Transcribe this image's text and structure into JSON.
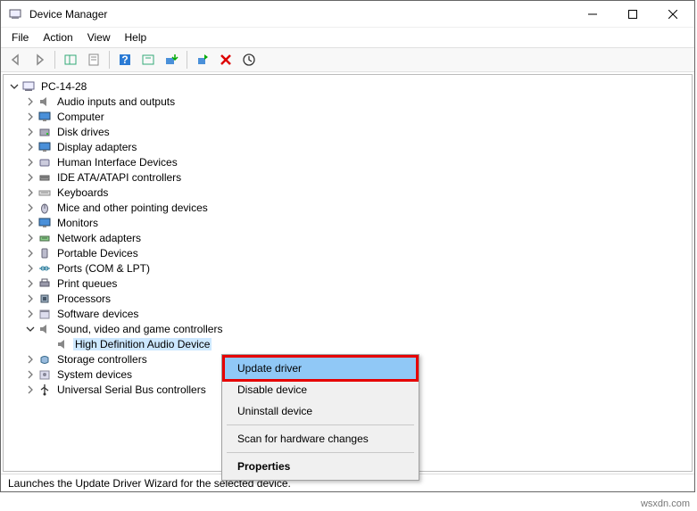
{
  "title": "Device Manager",
  "menu": {
    "file": "File",
    "action": "Action",
    "view": "View",
    "help": "Help"
  },
  "root": "PC-14-28",
  "categories": [
    "Audio inputs and outputs",
    "Computer",
    "Disk drives",
    "Display adapters",
    "Human Interface Devices",
    "IDE ATA/ATAPI controllers",
    "Keyboards",
    "Mice and other pointing devices",
    "Monitors",
    "Network adapters",
    "Portable Devices",
    "Ports (COM & LPT)",
    "Print queues",
    "Processors",
    "Software devices",
    "Sound, video and game controllers",
    "Storage controllers",
    "System devices",
    "Universal Serial Bus controllers"
  ],
  "expanded_child": "High Definition Audio Device",
  "context": {
    "update": "Update driver",
    "disable": "Disable device",
    "uninstall": "Uninstall device",
    "scan": "Scan for hardware changes",
    "properties": "Properties"
  },
  "status": "Launches the Update Driver Wizard for the selected device.",
  "watermark": "wsxdn.com"
}
